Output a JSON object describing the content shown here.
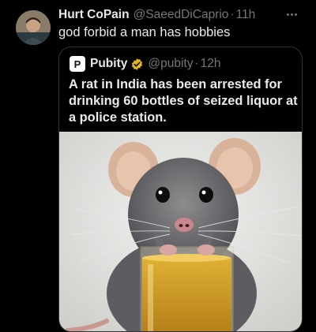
{
  "tweet": {
    "author_name": "Hurt CoPain",
    "author_handle": "@SaeedDiCaprio",
    "separator": "·",
    "time": "11h",
    "text": "god forbid a man has hobbies",
    "avatar_icon": "user-avatar",
    "more_icon": "more-horizontal-icon"
  },
  "quoted_tweet": {
    "avatar_letter": "P",
    "author_name": "Pubity",
    "verified_icon": "verified-gold-badge-icon",
    "author_handle": "@pubity",
    "separator": "·",
    "time": "12h",
    "text": "A rat in India has been arrested for drinking 60 bottles of seized liquor at a police station.",
    "image": "rat-drinking-liquor-photo"
  },
  "colors": {
    "background": "#000000",
    "text_primary": "#e7e9ea",
    "text_secondary": "#71767b",
    "border": "#2f3336",
    "verified_gold": "#e2b719"
  }
}
